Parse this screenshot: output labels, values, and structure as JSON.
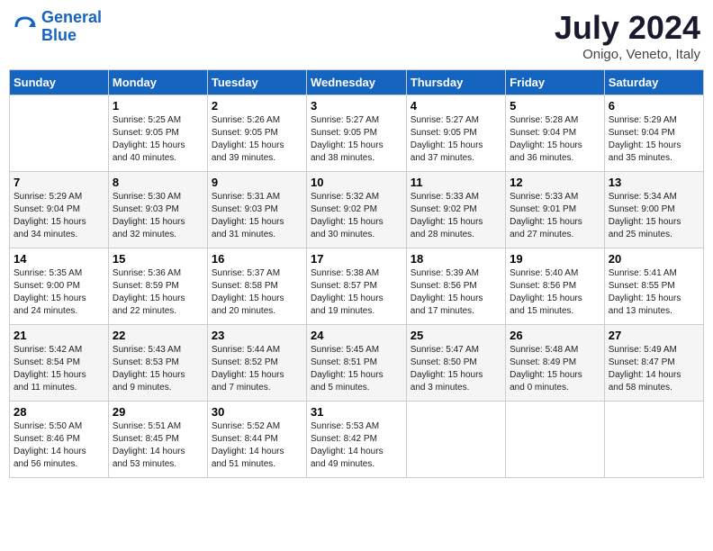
{
  "header": {
    "logo_line1": "General",
    "logo_line2": "Blue",
    "month_title": "July 2024",
    "subtitle": "Onigo, Veneto, Italy"
  },
  "days_of_week": [
    "Sunday",
    "Monday",
    "Tuesday",
    "Wednesday",
    "Thursday",
    "Friday",
    "Saturday"
  ],
  "weeks": [
    [
      {
        "day": "",
        "info": ""
      },
      {
        "day": "1",
        "info": "Sunrise: 5:25 AM\nSunset: 9:05 PM\nDaylight: 15 hours\nand 40 minutes."
      },
      {
        "day": "2",
        "info": "Sunrise: 5:26 AM\nSunset: 9:05 PM\nDaylight: 15 hours\nand 39 minutes."
      },
      {
        "day": "3",
        "info": "Sunrise: 5:27 AM\nSunset: 9:05 PM\nDaylight: 15 hours\nand 38 minutes."
      },
      {
        "day": "4",
        "info": "Sunrise: 5:27 AM\nSunset: 9:05 PM\nDaylight: 15 hours\nand 37 minutes."
      },
      {
        "day": "5",
        "info": "Sunrise: 5:28 AM\nSunset: 9:04 PM\nDaylight: 15 hours\nand 36 minutes."
      },
      {
        "day": "6",
        "info": "Sunrise: 5:29 AM\nSunset: 9:04 PM\nDaylight: 15 hours\nand 35 minutes."
      }
    ],
    [
      {
        "day": "7",
        "info": "Sunrise: 5:29 AM\nSunset: 9:04 PM\nDaylight: 15 hours\nand 34 minutes."
      },
      {
        "day": "8",
        "info": "Sunrise: 5:30 AM\nSunset: 9:03 PM\nDaylight: 15 hours\nand 32 minutes."
      },
      {
        "day": "9",
        "info": "Sunrise: 5:31 AM\nSunset: 9:03 PM\nDaylight: 15 hours\nand 31 minutes."
      },
      {
        "day": "10",
        "info": "Sunrise: 5:32 AM\nSunset: 9:02 PM\nDaylight: 15 hours\nand 30 minutes."
      },
      {
        "day": "11",
        "info": "Sunrise: 5:33 AM\nSunset: 9:02 PM\nDaylight: 15 hours\nand 28 minutes."
      },
      {
        "day": "12",
        "info": "Sunrise: 5:33 AM\nSunset: 9:01 PM\nDaylight: 15 hours\nand 27 minutes."
      },
      {
        "day": "13",
        "info": "Sunrise: 5:34 AM\nSunset: 9:00 PM\nDaylight: 15 hours\nand 25 minutes."
      }
    ],
    [
      {
        "day": "14",
        "info": "Sunrise: 5:35 AM\nSunset: 9:00 PM\nDaylight: 15 hours\nand 24 minutes."
      },
      {
        "day": "15",
        "info": "Sunrise: 5:36 AM\nSunset: 8:59 PM\nDaylight: 15 hours\nand 22 minutes."
      },
      {
        "day": "16",
        "info": "Sunrise: 5:37 AM\nSunset: 8:58 PM\nDaylight: 15 hours\nand 20 minutes."
      },
      {
        "day": "17",
        "info": "Sunrise: 5:38 AM\nSunset: 8:57 PM\nDaylight: 15 hours\nand 19 minutes."
      },
      {
        "day": "18",
        "info": "Sunrise: 5:39 AM\nSunset: 8:56 PM\nDaylight: 15 hours\nand 17 minutes."
      },
      {
        "day": "19",
        "info": "Sunrise: 5:40 AM\nSunset: 8:56 PM\nDaylight: 15 hours\nand 15 minutes."
      },
      {
        "day": "20",
        "info": "Sunrise: 5:41 AM\nSunset: 8:55 PM\nDaylight: 15 hours\nand 13 minutes."
      }
    ],
    [
      {
        "day": "21",
        "info": "Sunrise: 5:42 AM\nSunset: 8:54 PM\nDaylight: 15 hours\nand 11 minutes."
      },
      {
        "day": "22",
        "info": "Sunrise: 5:43 AM\nSunset: 8:53 PM\nDaylight: 15 hours\nand 9 minutes."
      },
      {
        "day": "23",
        "info": "Sunrise: 5:44 AM\nSunset: 8:52 PM\nDaylight: 15 hours\nand 7 minutes."
      },
      {
        "day": "24",
        "info": "Sunrise: 5:45 AM\nSunset: 8:51 PM\nDaylight: 15 hours\nand 5 minutes."
      },
      {
        "day": "25",
        "info": "Sunrise: 5:47 AM\nSunset: 8:50 PM\nDaylight: 15 hours\nand 3 minutes."
      },
      {
        "day": "26",
        "info": "Sunrise: 5:48 AM\nSunset: 8:49 PM\nDaylight: 15 hours\nand 0 minutes."
      },
      {
        "day": "27",
        "info": "Sunrise: 5:49 AM\nSunset: 8:47 PM\nDaylight: 14 hours\nand 58 minutes."
      }
    ],
    [
      {
        "day": "28",
        "info": "Sunrise: 5:50 AM\nSunset: 8:46 PM\nDaylight: 14 hours\nand 56 minutes."
      },
      {
        "day": "29",
        "info": "Sunrise: 5:51 AM\nSunset: 8:45 PM\nDaylight: 14 hours\nand 53 minutes."
      },
      {
        "day": "30",
        "info": "Sunrise: 5:52 AM\nSunset: 8:44 PM\nDaylight: 14 hours\nand 51 minutes."
      },
      {
        "day": "31",
        "info": "Sunrise: 5:53 AM\nSunset: 8:42 PM\nDaylight: 14 hours\nand 49 minutes."
      },
      {
        "day": "",
        "info": ""
      },
      {
        "day": "",
        "info": ""
      },
      {
        "day": "",
        "info": ""
      }
    ]
  ]
}
